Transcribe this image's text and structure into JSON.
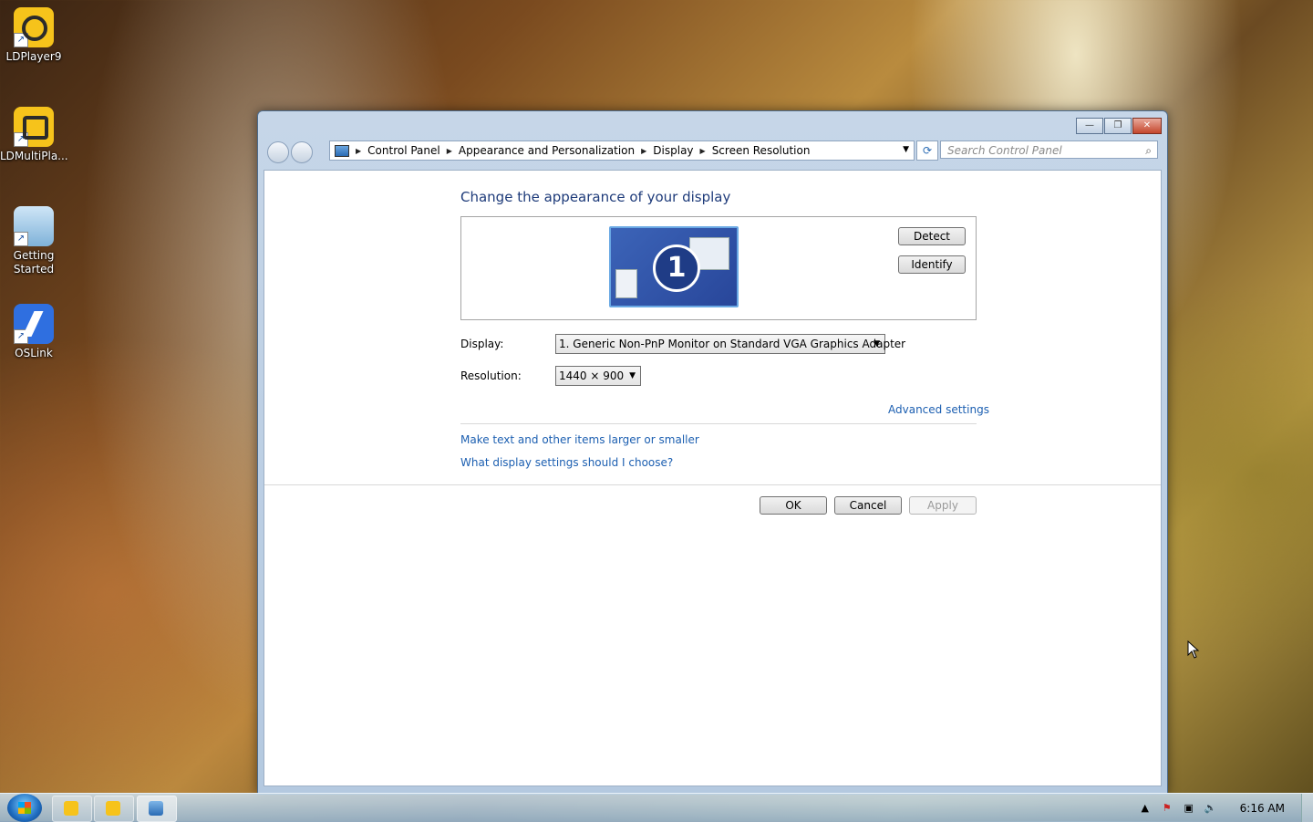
{
  "desktop": {
    "icons": [
      {
        "label": "LDPlayer9",
        "icon": "ldplayer-icon"
      },
      {
        "label": "LDMultiPla...",
        "icon": "ldmultiplayer-icon"
      },
      {
        "label": "Getting Started",
        "icon": "getting-started-icon"
      },
      {
        "label": "OSLink",
        "icon": "oslink-icon"
      }
    ]
  },
  "window": {
    "caption_buttons": {
      "minimize": "—",
      "maximize": "❐",
      "close": "✕"
    },
    "breadcrumb": [
      "Control Panel",
      "Appearance and Personalization",
      "Display",
      "Screen Resolution"
    ],
    "search_placeholder": "Search Control Panel",
    "heading": "Change the appearance of your display",
    "monitor_number": "1",
    "detect_label": "Detect",
    "identify_label": "Identify",
    "display_label": "Display:",
    "display_value": "1. Generic Non-PnP Monitor on Standard VGA Graphics Adapter",
    "resolution_label": "Resolution:",
    "resolution_value": "1440 × 900",
    "advanced_link": "Advanced settings",
    "link_text_size": "Make text and other items larger or smaller",
    "link_help": "What display settings should I choose?",
    "ok_label": "OK",
    "cancel_label": "Cancel",
    "apply_label": "Apply"
  },
  "taskbar": {
    "clock": "6:16 AM",
    "pinned": [
      "ldplayer-icon",
      "ldmultiplayer-icon",
      "display-settings-icon"
    ]
  },
  "colors": {
    "accent_heading": "#1e3b7a",
    "link": "#1c5fb1"
  }
}
